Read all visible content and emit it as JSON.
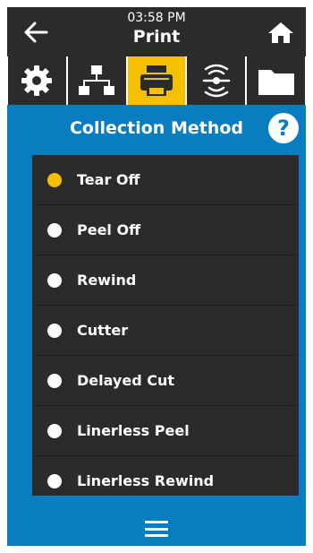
{
  "header": {
    "time": "03:58 PM",
    "title": "Print",
    "back_icon": "back-arrow-icon",
    "home_icon": "home-icon"
  },
  "tabs": [
    {
      "icon": "gear-icon",
      "active": false
    },
    {
      "icon": "network-icon",
      "active": false
    },
    {
      "icon": "printer-icon",
      "active": true
    },
    {
      "icon": "sensor-icon",
      "active": false
    },
    {
      "icon": "folder-icon",
      "active": false
    }
  ],
  "section": {
    "title": "Collection Method",
    "help_label": "?"
  },
  "options": [
    {
      "label": "Tear Off",
      "selected": true
    },
    {
      "label": "Peel Off",
      "selected": false
    },
    {
      "label": "Rewind",
      "selected": false
    },
    {
      "label": "Cutter",
      "selected": false
    },
    {
      "label": "Delayed Cut",
      "selected": false
    },
    {
      "label": "Linerless Peel",
      "selected": false
    },
    {
      "label": "Linerless Rewind",
      "selected": false
    }
  ],
  "footer": {
    "menu_icon": "hamburger-menu-icon"
  },
  "colors": {
    "background": "#0a7cc0",
    "dark": "#2b2b2b",
    "accent": "#f5c000",
    "text": "#ffffff"
  }
}
